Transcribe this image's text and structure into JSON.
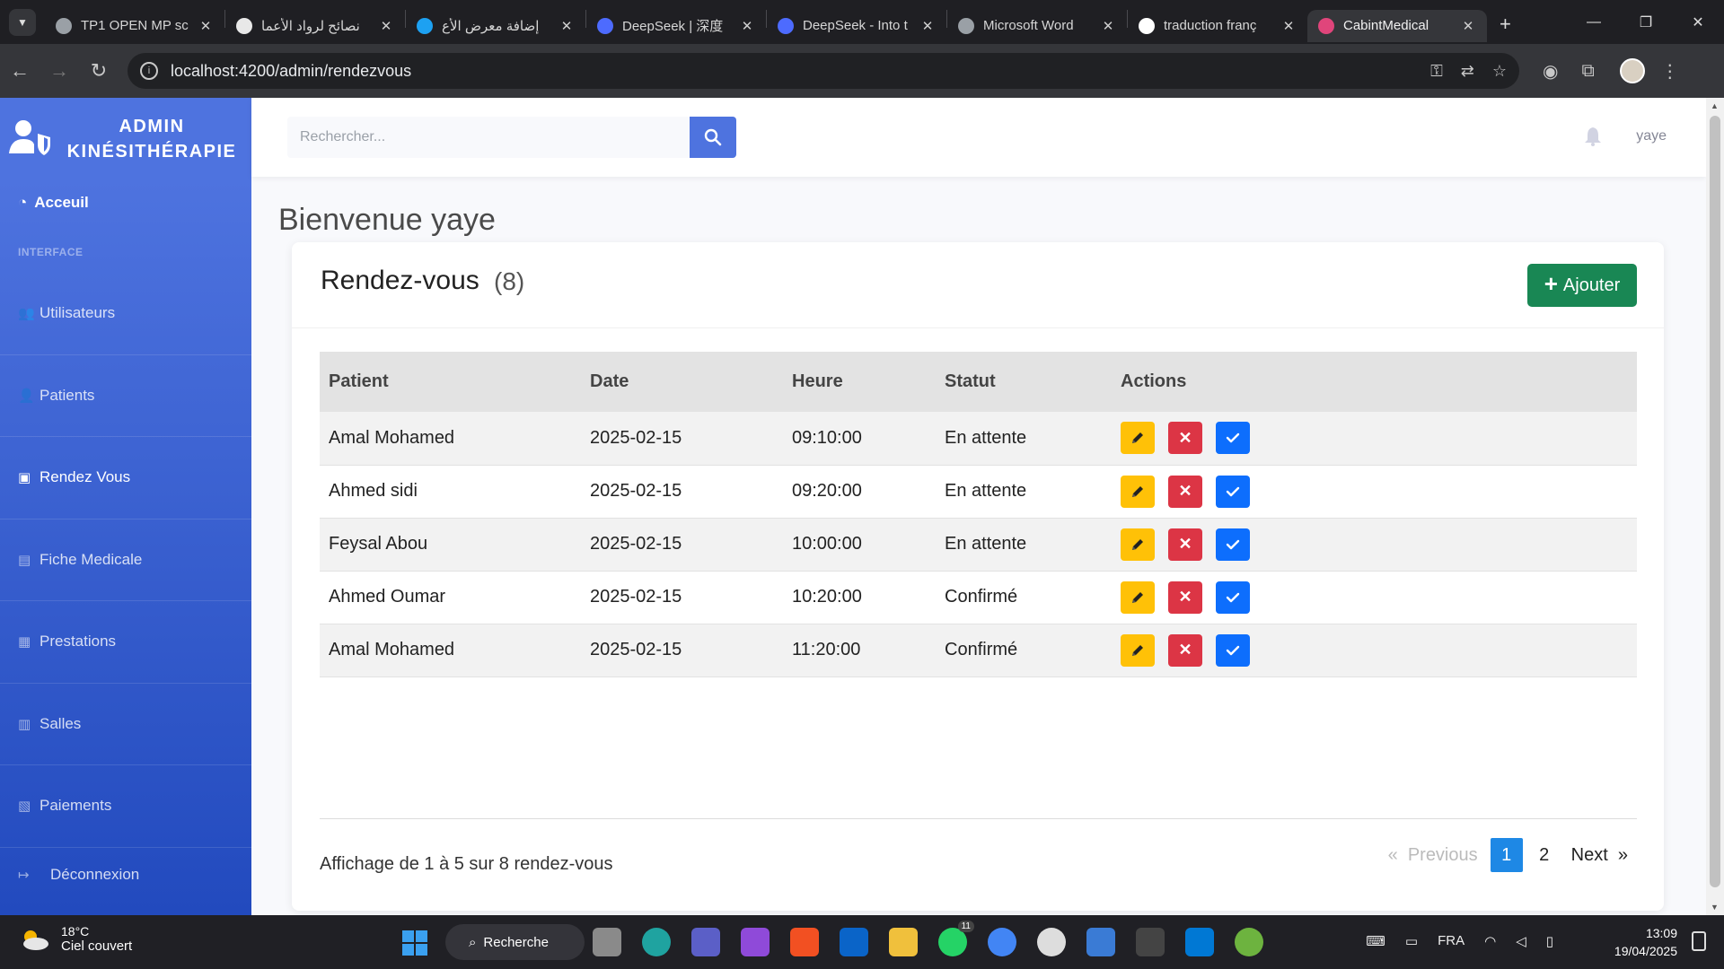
{
  "browser": {
    "tabs": [
      {
        "title": "TP1 OPEN MP sc",
        "fav_color": "#9aa0a6"
      },
      {
        "title": "نصائح لرواد الأعما",
        "fav_color": "#e8e8e8"
      },
      {
        "title": "إضافة معرض الأع",
        "fav_color": "#1da1f2"
      },
      {
        "title": "DeepSeek | 深度",
        "fav_color": "#4d6bfe"
      },
      {
        "title": "DeepSeek - Into t",
        "fav_color": "#4d6bfe"
      },
      {
        "title": "Microsoft Word",
        "fav_color": "#9aa0a6"
      },
      {
        "title": "traduction franç",
        "fav_color": "#ffffff"
      },
      {
        "title": "CabintMedical",
        "fav_color": "#e0457b"
      }
    ],
    "active_tab_index": 7,
    "url": "localhost:4200/admin/rendezvous"
  },
  "sidebar": {
    "brand_line1": "ADMIN",
    "brand_line2": "KINÉSITHÉRAPIE",
    "home_label": "Acceuil",
    "section_heading": "INTERFACE",
    "items": [
      {
        "label": "Utilisateurs",
        "icon": "users-icon"
      },
      {
        "label": "Patients",
        "icon": "user-icon"
      },
      {
        "label": "Rendez Vous",
        "icon": "calendar-check-icon"
      },
      {
        "label": "Fiche Medicale",
        "icon": "file-icon"
      },
      {
        "label": "Prestations",
        "icon": "briefcase-icon"
      },
      {
        "label": "Salles",
        "icon": "bed-icon"
      },
      {
        "label": "Paiements",
        "icon": "money-icon"
      },
      {
        "label": "Déconnexion",
        "icon": "sign-out-icon"
      }
    ]
  },
  "topbar": {
    "search_placeholder": "Rechercher...",
    "username": "yaye"
  },
  "main": {
    "welcome": "Bienvenue yaye",
    "card_title": "Rendez-vous",
    "card_count": "(8)",
    "add_label": "Ajouter",
    "table": {
      "headers": [
        "Patient",
        "Date",
        "Heure",
        "Statut",
        "Actions"
      ],
      "rows": [
        {
          "patient": "Amal Mohamed",
          "date": "2025-02-15",
          "heure": "09:10:00",
          "statut": "En attente"
        },
        {
          "patient": "Ahmed sidi",
          "date": "2025-02-15",
          "heure": "09:20:00",
          "statut": "En attente"
        },
        {
          "patient": "Feysal Abou",
          "date": "2025-02-15",
          "heure": "10:00:00",
          "statut": "En attente"
        },
        {
          "patient": "Ahmed Oumar",
          "date": "2025-02-15",
          "heure": "10:20:00",
          "statut": "Confirmé"
        },
        {
          "patient": "Amal Mohamed",
          "date": "2025-02-15",
          "heure": "11:20:00",
          "statut": "Confirmé"
        }
      ]
    },
    "info": "Affichage de 1 à 5 sur 8 rendez-vous",
    "pagination": {
      "previous": "Previous",
      "pages": [
        "1",
        "2"
      ],
      "current": "1",
      "next": "Next"
    }
  },
  "taskbar": {
    "temperature": "18°C",
    "weather": "Ciel couvert",
    "search_label": "Recherche",
    "whatsapp_badge": "11",
    "language": "FRA",
    "time": "13:09",
    "date": "19/04/2025"
  },
  "colors": {
    "primary": "#4e73df",
    "success": "#198754",
    "warning": "#ffc107",
    "danger": "#dc3545",
    "info": "#0d6efd"
  }
}
